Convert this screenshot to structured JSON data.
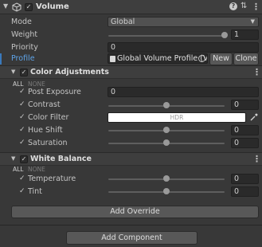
{
  "header": {
    "title": "Volume",
    "enabled_check": "✓",
    "help_icon": "?",
    "settings_icon": "⇅",
    "menu_icon": "⋮"
  },
  "volume": {
    "mode_label": "Mode",
    "mode_value": "Global",
    "weight_label": "Weight",
    "weight_value": "1",
    "weight_fraction": 1.0,
    "priority_label": "Priority",
    "priority_value": "0",
    "profile_label": "Profile",
    "profile_value": "Global Volume Profile (V",
    "new_label": "New",
    "clone_label": "Clone"
  },
  "color_adjustments": {
    "title": "Color Adjustments",
    "all": "ALL",
    "none": "NONE",
    "post_exposure_label": "Post Exposure",
    "post_exposure_value": "0",
    "contrast_label": "Contrast",
    "contrast_value": "0",
    "contrast_fraction": 0.5,
    "color_filter_label": "Color Filter",
    "color_filter_hdr": "HDR",
    "hue_shift_label": "Hue Shift",
    "hue_shift_value": "0",
    "hue_shift_fraction": 0.5,
    "saturation_label": "Saturation",
    "saturation_value": "0",
    "saturation_fraction": 0.5
  },
  "white_balance": {
    "title": "White Balance",
    "all": "ALL",
    "none": "NONE",
    "temperature_label": "Temperature",
    "temperature_value": "0",
    "temperature_fraction": 0.5,
    "tint_label": "Tint",
    "tint_value": "0",
    "tint_fraction": 0.5
  },
  "buttons": {
    "add_override": "Add Override",
    "add_component": "Add Component"
  },
  "colors": {
    "accent": "#3a79bb",
    "background": "#383838"
  }
}
